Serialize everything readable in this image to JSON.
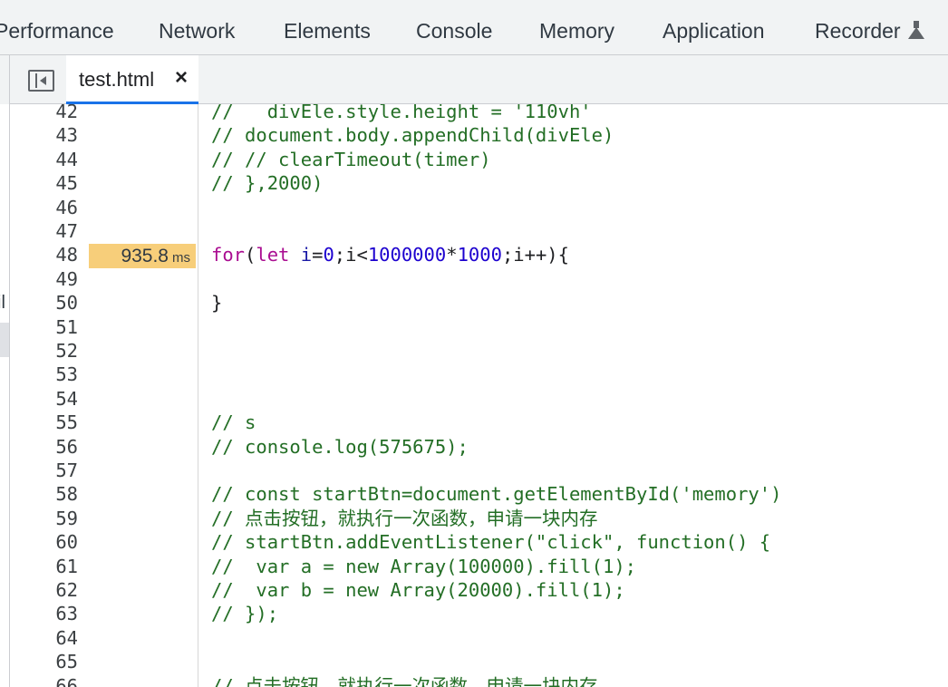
{
  "panel_tabs": [
    "Performance",
    "Network",
    "Elements",
    "Console",
    "Memory",
    "Application",
    "Recorder"
  ],
  "file_tab": {
    "name": "test.html",
    "close": "×"
  },
  "left_strip_text": "il",
  "code_lines": [
    {
      "ln": "42",
      "type": "comment",
      "text": "//   divEle.style.height = '110vh'"
    },
    {
      "ln": "43",
      "type": "comment",
      "text": "// document.body.appendChild(divEle)"
    },
    {
      "ln": "44",
      "type": "comment",
      "text": "// // clearTimeout(timer)"
    },
    {
      "ln": "45",
      "type": "comment",
      "text": "// },2000)"
    },
    {
      "ln": "46",
      "type": "empty",
      "text": ""
    },
    {
      "ln": "47",
      "type": "empty",
      "text": ""
    },
    {
      "ln": "48",
      "type": "for",
      "text": "",
      "timing": "935.8",
      "timing_unit": "ms",
      "tokens": {
        "kw1": "for",
        "p1": "(",
        "kw2": "let",
        "sp": " ",
        "id1": "i",
        "p2": "=",
        "n1": "0",
        "p3": ";",
        "id2": "i",
        "p4": "<",
        "n2": "1000000",
        "p5": "*",
        "n3": "1000",
        "p6": ";",
        "id3": "i",
        "p7": "++){"
      }
    },
    {
      "ln": "49",
      "type": "empty",
      "text": ""
    },
    {
      "ln": "50",
      "type": "plain",
      "text": "}"
    },
    {
      "ln": "51",
      "type": "empty",
      "text": ""
    },
    {
      "ln": "52",
      "type": "empty",
      "text": ""
    },
    {
      "ln": "53",
      "type": "empty",
      "text": ""
    },
    {
      "ln": "54",
      "type": "empty",
      "text": ""
    },
    {
      "ln": "55",
      "type": "comment",
      "text": "// s"
    },
    {
      "ln": "56",
      "type": "comment",
      "text": "// console.log(575675);"
    },
    {
      "ln": "57",
      "type": "empty",
      "text": ""
    },
    {
      "ln": "58",
      "type": "comment",
      "text": "// const startBtn=document.getElementById('memory')"
    },
    {
      "ln": "59",
      "type": "comment",
      "text": "// 点击按钮，就执行一次函数，申请一块内存"
    },
    {
      "ln": "60",
      "type": "comment",
      "text": "// startBtn.addEventListener(\"click\", function() {"
    },
    {
      "ln": "61",
      "type": "comment",
      "text": "//  var a = new Array(100000).fill(1);"
    },
    {
      "ln": "62",
      "type": "comment",
      "text": "//  var b = new Array(20000).fill(1);"
    },
    {
      "ln": "63",
      "type": "comment",
      "text": "// });"
    },
    {
      "ln": "64",
      "type": "empty",
      "text": ""
    },
    {
      "ln": "65",
      "type": "empty",
      "text": ""
    },
    {
      "ln": "66",
      "type": "comment",
      "text": "// 点击按钮，就执行一次函数，申请一块内存"
    }
  ]
}
